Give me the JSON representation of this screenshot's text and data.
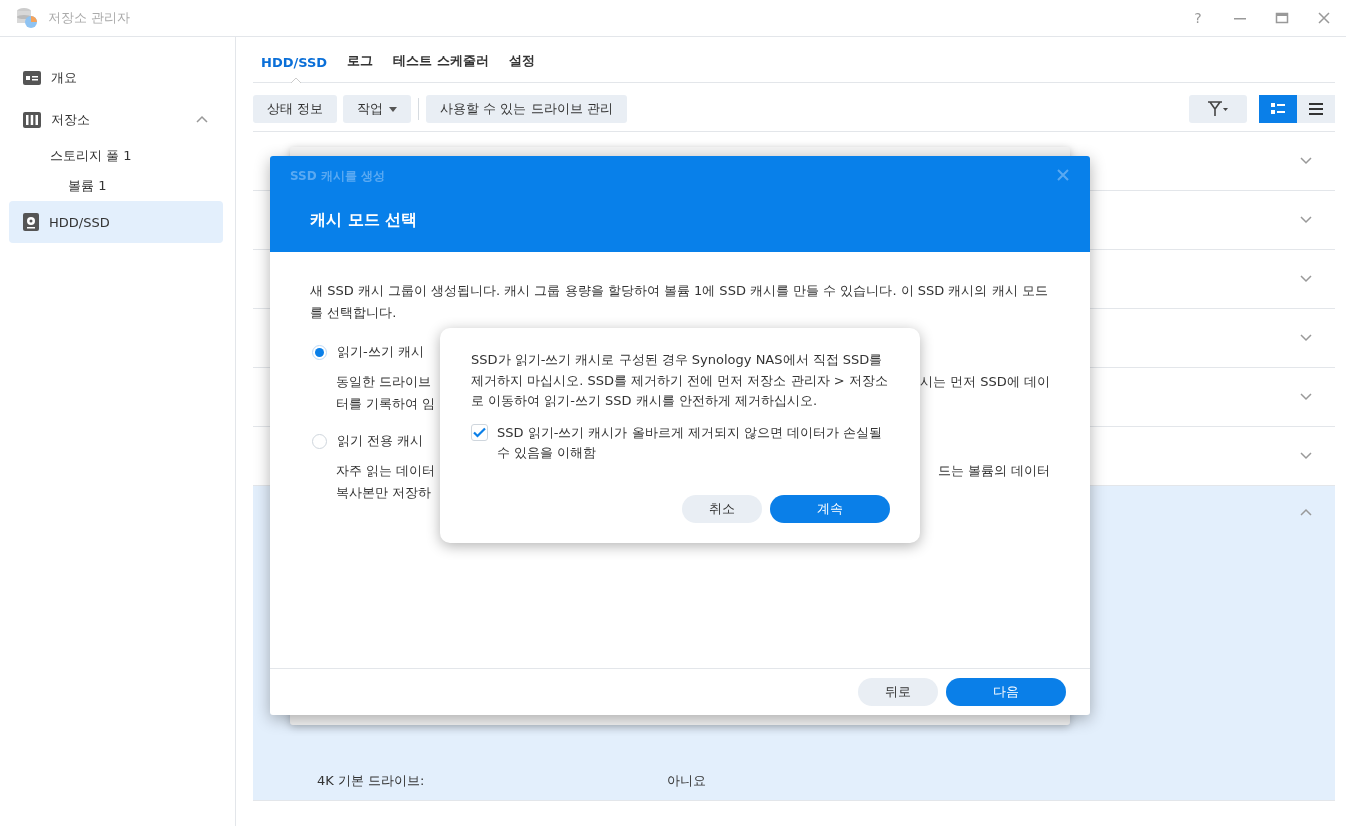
{
  "window": {
    "title": "저장소 관리자",
    "help": "?"
  },
  "sidebar": {
    "items": [
      {
        "label": "개요",
        "kind": "overview",
        "selected": false
      },
      {
        "label": "저장소",
        "kind": "storage",
        "selected": false,
        "expanded": true,
        "children": [
          {
            "label": "스토리지 풀 1",
            "selected": false,
            "children": [
              {
                "label": "볼륨 1",
                "selected": false
              }
            ]
          }
        ]
      },
      {
        "label": "HDD/SSD",
        "kind": "disk",
        "selected": true
      }
    ]
  },
  "tabs": [
    {
      "label": "HDD/SSD",
      "selected": true
    },
    {
      "label": "로그",
      "selected": false
    },
    {
      "label": "테스트 스케줄러",
      "selected": false
    },
    {
      "label": "설정",
      "selected": false
    }
  ],
  "toolbar": {
    "buttons": [
      {
        "label": "상태 정보",
        "kind": "plain"
      },
      {
        "label": "작업",
        "kind": "dropdown"
      },
      {
        "label": "사용할 수 있는 드라이브 관리",
        "kind": "plain"
      }
    ],
    "view_modes": [
      {
        "kind": "tiles",
        "selected": true
      },
      {
        "kind": "list",
        "selected": false
      }
    ]
  },
  "drive_list": {
    "rows": [
      {
        "expanded": false
      },
      {
        "expanded": false
      },
      {
        "expanded": false
      },
      {
        "expanded": false
      },
      {
        "expanded": false
      },
      {
        "expanded": false
      },
      {
        "expanded": true,
        "details": [
          {
            "label": "4K 기본 드라이브:",
            "value": "아니요"
          }
        ]
      }
    ]
  },
  "wizard": {
    "title": "SSD 캐시를 생성",
    "step_title": "캐시 모드 선택",
    "intro": "새 SSD 캐시 그룹이 생성됩니다. 캐시 그룹 용량을 할당하여 볼륨 1에 SSD 캐시를 만들 수 있습니다. 이 SSD 캐시의 캐시 모드를 선택합니다.",
    "options": [
      {
        "label": "읽기-쓰기 캐시",
        "selected": true,
        "lines": [
          {
            "left": "동일한 드라이브",
            "right": "시는 먼저 SSD에 데이"
          },
          {
            "left": "터를 기록하여 임"
          }
        ]
      },
      {
        "label": "읽기 전용 캐시",
        "selected": false,
        "lines": [
          {
            "left": "자주 읽는 데이터",
            "right": "드는 볼륨의 데이터"
          },
          {
            "left": "복사본만 저장하"
          }
        ]
      }
    ],
    "buttons": [
      {
        "label": "뒤로",
        "kind": "secondary"
      },
      {
        "label": "다음",
        "kind": "primary"
      }
    ]
  },
  "confirm": {
    "message": "SSD가 읽기-쓰기 캐시로 구성된 경우 Synology NAS에서 직접 SSD를 제거하지 마십시오. SSD를 제거하기 전에 먼저 저장소 관리자 > 저장소로 이동하여 읽기-쓰기 SSD 캐시를 안전하게 제거하십시오.",
    "checkbox": {
      "label": "SSD 읽기-쓰기 캐시가 올바르게 제거되지 않으면 데이터가 손실될 수 있음을 이해함",
      "checked": true
    },
    "buttons": [
      {
        "label": "취소",
        "kind": "secondary"
      },
      {
        "label": "계속",
        "kind": "primary"
      }
    ]
  }
}
